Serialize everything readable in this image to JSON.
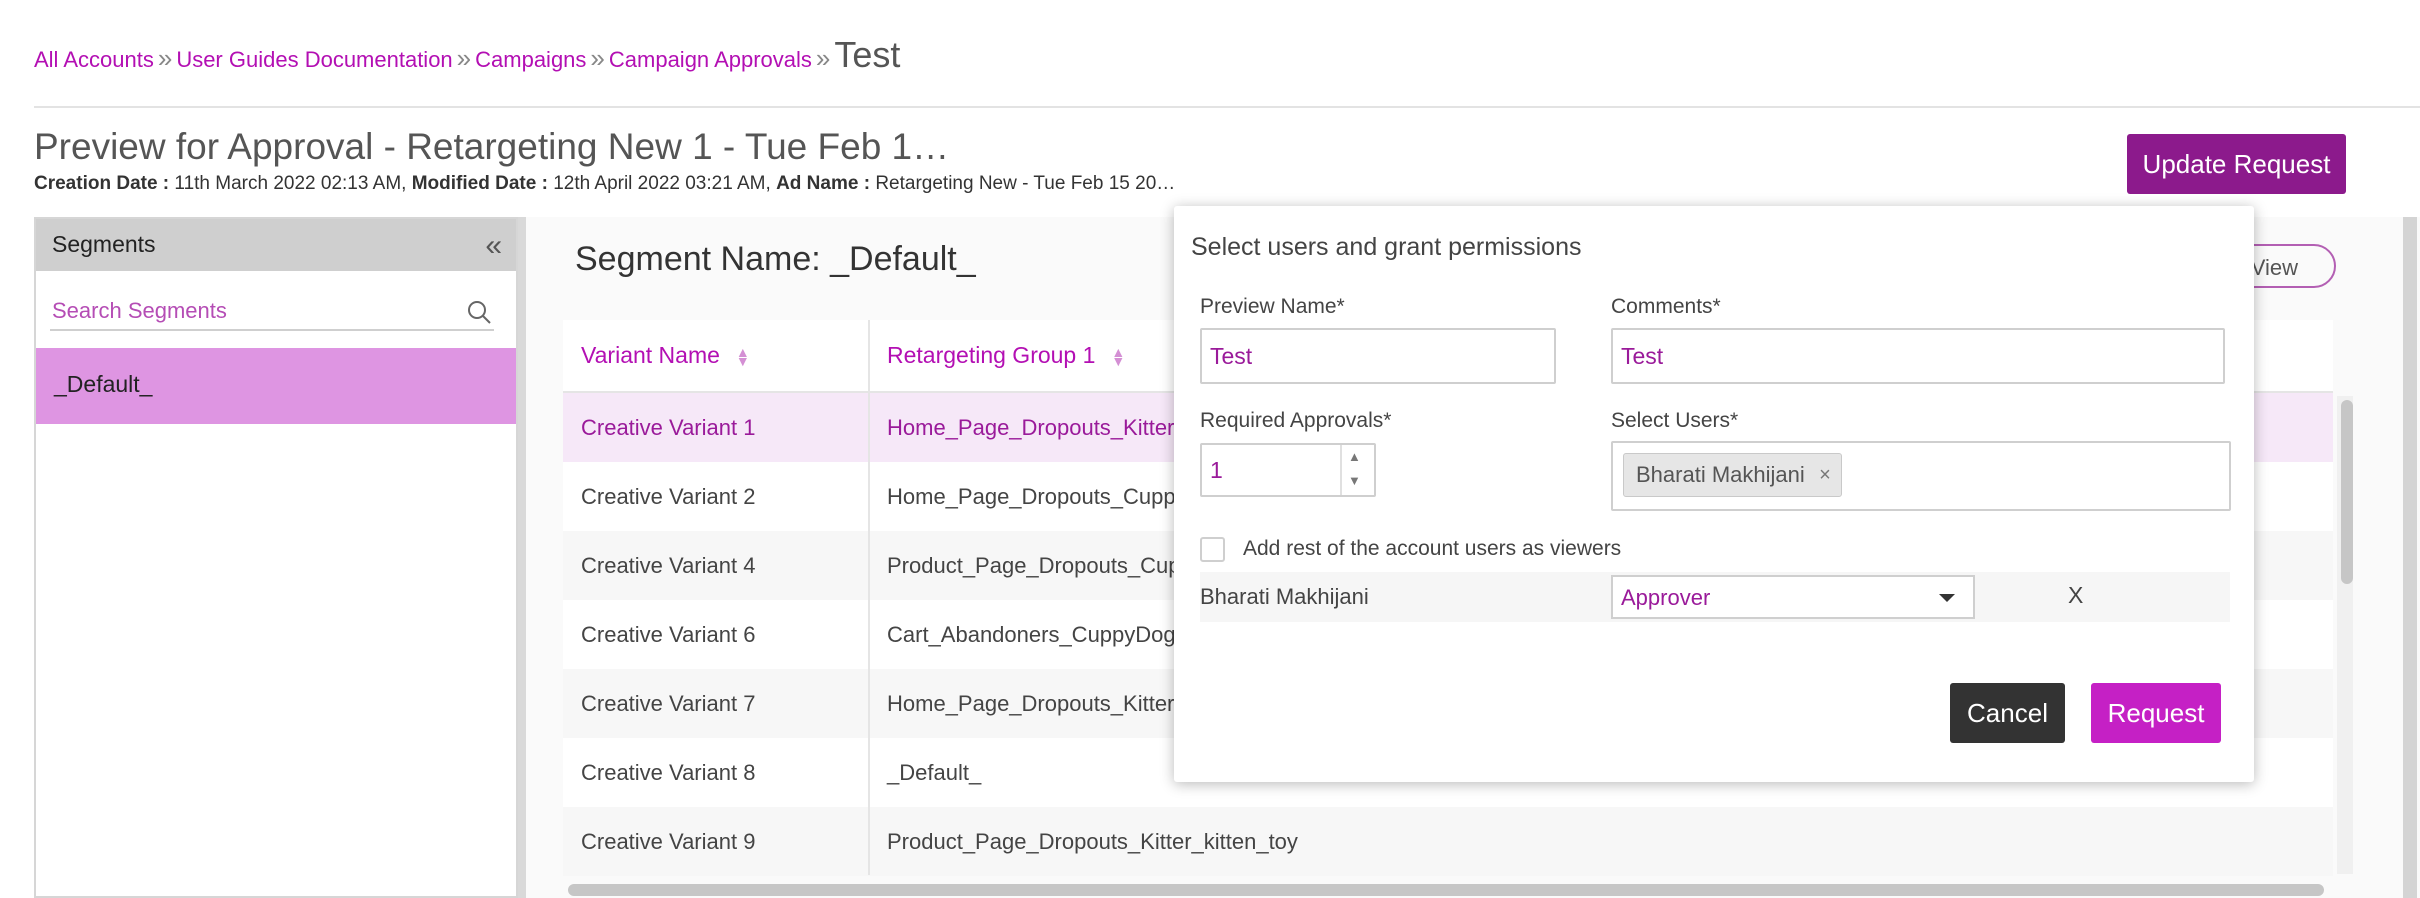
{
  "breadcrumb": {
    "items": [
      "All Accounts",
      "User Guides Documentation",
      "Campaigns",
      "Campaign Approvals"
    ],
    "separator": "»",
    "current": "Test"
  },
  "header": {
    "title": "Preview for Approval - Retargeting New 1 - Tue Feb 1…",
    "creation_label": "Creation Date :",
    "creation_value": "11th March 2022 02:13 AM,",
    "modified_label": "Modified Date :",
    "modified_value": "12th April 2022 03:21 AM,",
    "ad_label": "Ad Name :",
    "ad_value": "Retargeting New - Tue Feb 15 20…",
    "update_button": "Update Request"
  },
  "segments": {
    "title": "Segments",
    "collapse_icon": "«",
    "search_placeholder": "Search Segments",
    "items": [
      {
        "label": "_Default_",
        "selected": true
      }
    ]
  },
  "main": {
    "segment_name": "Segment Name: _Default_",
    "view_label": "View",
    "table": {
      "columns": [
        "Variant Name",
        "Retargeting Group 1"
      ],
      "rows": [
        {
          "variant": "Creative Variant 1",
          "group": "Home_Page_Dropouts_Kitter_",
          "state": "selected"
        },
        {
          "variant": "Creative Variant 2",
          "group": "Home_Page_Dropouts_Cuppy",
          "state": "normal"
        },
        {
          "variant": "Creative Variant 4",
          "group": "Product_Page_Dropouts_Cup",
          "state": "alt"
        },
        {
          "variant": "Creative Variant 6",
          "group": "Cart_Abandoners_CuppyDog_",
          "state": "normal"
        },
        {
          "variant": "Creative Variant 7",
          "group": "Home_Page_Dropouts_Kitter_",
          "state": "alt"
        },
        {
          "variant": "Creative Variant 8",
          "group": "_Default_",
          "state": "normal"
        },
        {
          "variant": "Creative Variant 9",
          "group": "Product_Page_Dropouts_Kitter_kitten_toy",
          "state": "alt"
        }
      ]
    }
  },
  "modal": {
    "title": "Select users and grant permissions",
    "preview_name_label": "Preview Name*",
    "preview_name_value": "Test",
    "comments_label": "Comments*",
    "comments_value": "Test",
    "required_approvals_label": "Required Approvals*",
    "required_approvals_value": "1",
    "select_users_label": "Select Users*",
    "selected_user_chip": "Bharati Makhijani",
    "chip_close": "×",
    "checkbox_label": "Add rest of the account users as viewers",
    "permission_row": {
      "user": "Bharati Makhijani",
      "role": "Approver",
      "remove": "X"
    },
    "cancel_button": "Cancel",
    "request_button": "Request"
  },
  "colors": {
    "accent": "#b30fb3",
    "update_button": "#8c1a8c",
    "request_button": "#c520c5",
    "cancel_button": "#333333",
    "selected_segment": "#de95e2",
    "selected_row": "#f6e8f8"
  },
  "icons": {
    "search": "search-icon",
    "collapse": "double-chevron-left-icon",
    "sort": "sort-icon",
    "dropdown": "caret-down-icon"
  }
}
